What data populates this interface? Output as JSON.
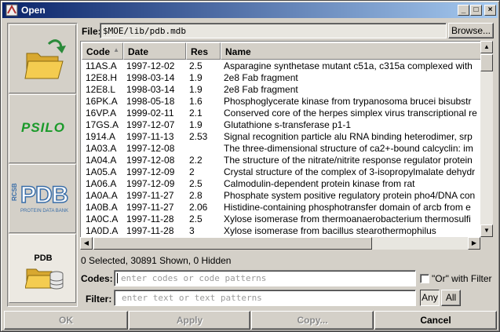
{
  "window": {
    "title": "Open"
  },
  "file": {
    "label": "File:",
    "value": "$MOE/lib/pdb.mdb",
    "browse_label": "Browse..."
  },
  "sidebar": {
    "items": [
      {
        "name": "open-folder",
        "label": ""
      },
      {
        "name": "psilo",
        "label": "PSILO"
      },
      {
        "name": "pdb",
        "label": "PDB",
        "sublabel": "PROTEIN DATA BANK",
        "prefix": "RCSB"
      },
      {
        "name": "pdb-database",
        "label": "PDB"
      }
    ]
  },
  "table": {
    "columns": [
      "Code",
      "Date",
      "Res",
      "Name"
    ],
    "rows": [
      [
        "11AS.A",
        "1997-12-02",
        "2.5",
        "Asparagine synthetase mutant c51a, c315a complexed with"
      ],
      [
        "12E8.H",
        "1998-03-14",
        "1.9",
        "2e8 Fab fragment"
      ],
      [
        "12E8.L",
        "1998-03-14",
        "1.9",
        "2e8 Fab fragment"
      ],
      [
        "16PK.A",
        "1998-05-18",
        "1.6",
        "Phosphoglycerate kinase from trypanosoma brucei bisubstr"
      ],
      [
        "16VP.A",
        "1999-02-11",
        "2.1",
        "Conserved core of the herpes simplex virus transcriptional re"
      ],
      [
        "17GS.A",
        "1997-12-07",
        "1.9",
        "Glutathione s-transferase p1-1"
      ],
      [
        "1914.A",
        "1997-11-13",
        "2.53",
        "Signal recognition particle alu RNA binding heterodimer, srp"
      ],
      [
        "1A03.A",
        "1997-12-08",
        "",
        "The three-dimensional structure of ca2+-bound calcyclin: im"
      ],
      [
        "1A04.A",
        "1997-12-08",
        "2.2",
        "The structure of the nitrate/nitrite response regulator protein"
      ],
      [
        "1A05.A",
        "1997-12-09",
        "2",
        "Crystal structure of the complex of 3-isopropylmalate dehydr"
      ],
      [
        "1A06.A",
        "1997-12-09",
        "2.5",
        "Calmodulin-dependent protein kinase from rat"
      ],
      [
        "1A0A.A",
        "1997-11-27",
        "2.8",
        "Phosphate system positive regulatory protein pho4/DNA con"
      ],
      [
        "1A0B.A",
        "1997-11-27",
        "2.06",
        "Histidine-containing phosphotransfer domain of arcb from e"
      ],
      [
        "1A0C.A",
        "1997-11-28",
        "2.5",
        "Xylose isomerase from thermoanaerobacterium thermosulfi"
      ],
      [
        "1A0D.A",
        "1997-11-28",
        "3",
        "Xylose isomerase from bacillus stearothermophilus"
      ]
    ]
  },
  "status": {
    "text": "0 Selected, 30891 Shown, 0 Hidden"
  },
  "codes": {
    "label": "Codes:",
    "placeholder": "enter codes or code patterns",
    "or_label": "\"Or\" with Filter"
  },
  "filter": {
    "label": "Filter:",
    "placeholder": "enter text or text patterns",
    "any_label": "Any",
    "all_label": "All"
  },
  "buttons": {
    "ok": "OK",
    "apply": "Apply",
    "copy": "Copy...",
    "cancel": "Cancel"
  },
  "colors": {
    "title_start": "#0a246a",
    "title_end": "#a6caf0",
    "psilo_green": "#1a9a2a",
    "pdb_blue": "#3a6ea8"
  }
}
